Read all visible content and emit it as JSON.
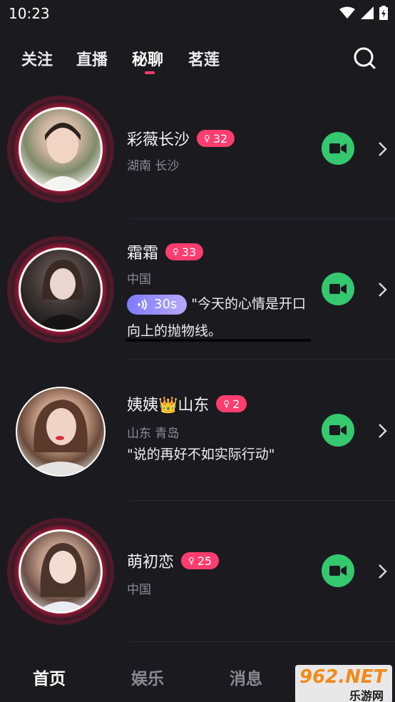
{
  "status_bar": {
    "time": "10:23"
  },
  "top_nav": {
    "tabs": [
      {
        "label": "关注"
      },
      {
        "label": "直播"
      },
      {
        "label": "秘聊"
      },
      {
        "label": "茗莲"
      }
    ],
    "active_tab": "秘聊"
  },
  "users": [
    {
      "name": "彩薇长沙",
      "level": "32",
      "location": "湖南 长沙"
    },
    {
      "name": "霜霜",
      "level": "33",
      "location": "中国",
      "voice_duration": "30s",
      "quote": "\"今天的心情是开口向上的抛物线。"
    },
    {
      "name": "姨姨👑山东",
      "level": "2",
      "location": "山东 青岛",
      "quote": "\"说的再好不如实际行动\""
    },
    {
      "name": "萌初恋",
      "level": "25",
      "location": "中国"
    }
  ],
  "bottom_nav": {
    "tabs": [
      {
        "label": "首页"
      },
      {
        "label": "娱乐"
      },
      {
        "label": "消息"
      }
    ],
    "active_tab": "首页"
  },
  "watermark": {
    "top": "962.NET",
    "bottom": "乐游网"
  },
  "colors": {
    "accent": "#ff3d6f",
    "video_button": "#35c86f",
    "background": "#1b1a1f",
    "voice_gradient": "#7c7bff"
  }
}
